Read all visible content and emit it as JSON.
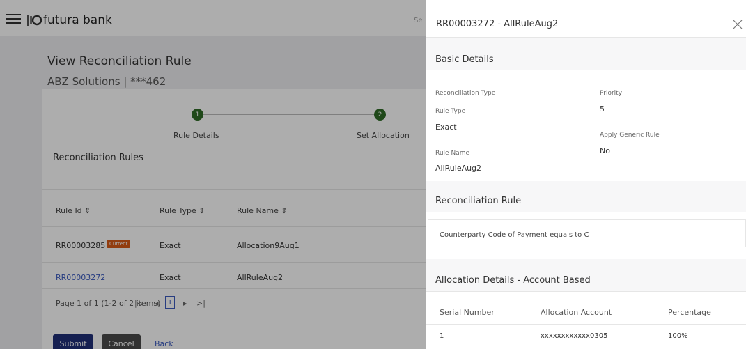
{
  "app": {
    "logo_text": "futura bank",
    "search_stub": "Se"
  },
  "page": {
    "title": "View Reconciliation Rule",
    "subtitle": "ABZ Solutions | ***462",
    "steps": [
      {
        "number": "1",
        "label": "Rule Details"
      },
      {
        "number": "2",
        "label": "Set Allocation"
      }
    ],
    "section_title": "Reconciliation Rules",
    "table": {
      "headers": [
        "Rule Id",
        "Rule Type",
        "Rule Name"
      ],
      "sort_icon": "⇕",
      "rows": [
        {
          "rule_id": "RR00003285",
          "badge": "Current",
          "rule_type": "Exact",
          "rule_name": "Allocation9Aug1"
        },
        {
          "rule_id": "RR00003272",
          "badge": "",
          "rule_type": "Exact",
          "rule_name": "AllRuleAug2"
        }
      ]
    },
    "pagination": {
      "text": "Page    1   of 1    (1-2 of 2 items)",
      "first": "|<",
      "prev": "◂",
      "current": "1",
      "next": "▸",
      "last": ">|"
    },
    "buttons": {
      "submit": "Submit",
      "cancel": "Cancel",
      "back": "Back"
    }
  },
  "panel": {
    "title": "RR00003272 - AllRuleAug2",
    "basic_details": {
      "heading": "Basic Details",
      "reconciliation_type_label": "Reconciliation Type",
      "rule_type_label": "Rule Type",
      "rule_type_value": "Exact",
      "rule_name_label": "Rule Name",
      "rule_name_value": "AllRuleAug2",
      "priority_label": "Priority",
      "priority_value": "5",
      "apply_generic_label": "Apply Generic Rule",
      "apply_generic_value": "No"
    },
    "reconciliation_rule": {
      "heading": "Reconciliation Rule",
      "text": "Counterparty Code of Payment equals to C"
    },
    "allocation": {
      "heading": "Allocation Details - Account Based",
      "headers": [
        "Serial Number",
        "Allocation Account",
        "Percentage"
      ],
      "rows": [
        {
          "serial": "1",
          "account": "xxxxxxxxxxxx0305",
          "percentage": "100%"
        }
      ]
    }
  },
  "colors": {
    "primary": "#1f2f78",
    "step_green": "#2e6b26",
    "badge_orange": "#d85a17",
    "link_blue": "#3b5bbf"
  }
}
